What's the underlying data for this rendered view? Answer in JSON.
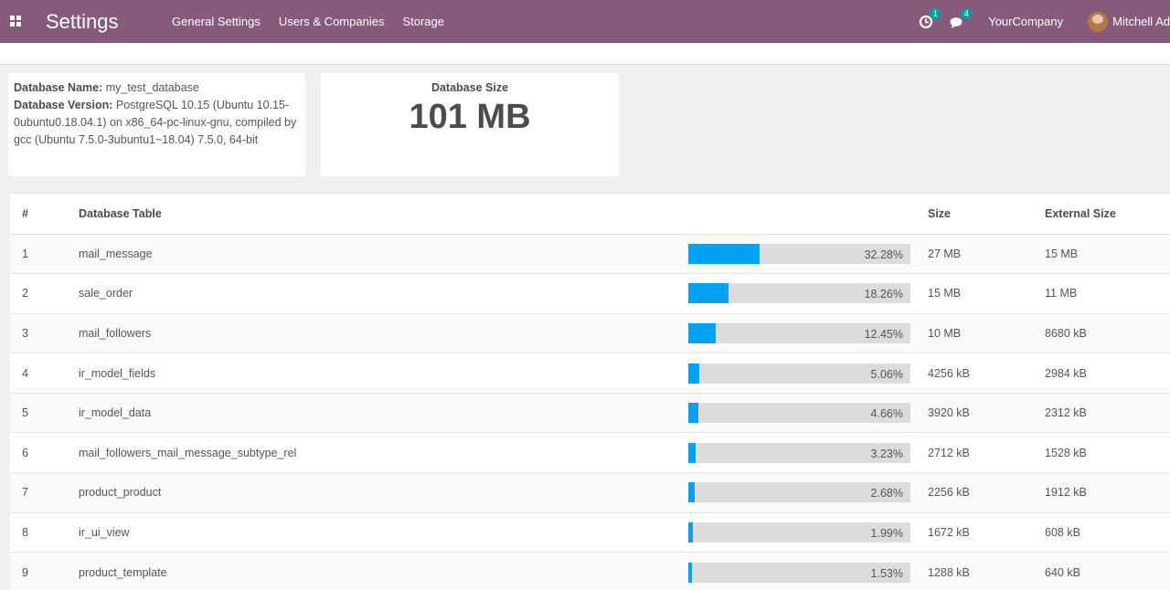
{
  "nav": {
    "app_title": "Settings",
    "menu": [
      "General Settings",
      "Users & Companies",
      "Storage"
    ],
    "activity_badge": "1",
    "messages_badge": "4",
    "company": "YourCompany",
    "user": "Mitchell Ad"
  },
  "db_info": {
    "name_label": "Database Name:",
    "name_value": "my_test_database",
    "version_label": "Database Version:",
    "version_value": "PostgreSQL 10.15 (Ubuntu 10.15-0ubuntu0.18.04.1) on x86_64-pc-linux-gnu, compiled by gcc (Ubuntu 7.5.0-3ubuntu1~18.04) 7.5.0, 64-bit"
  },
  "db_size": {
    "label": "Database Size",
    "value": "101 MB"
  },
  "table": {
    "headers": {
      "num": "#",
      "name": "Database Table",
      "size": "Size",
      "external": "External Size"
    },
    "rows": [
      {
        "num": "1",
        "name": "mail_message",
        "percent": 32.28,
        "percent_label": "32.28%",
        "size": "27 MB",
        "external": "15 MB"
      },
      {
        "num": "2",
        "name": "sale_order",
        "percent": 18.26,
        "percent_label": "18.26%",
        "size": "15 MB",
        "external": "11 MB"
      },
      {
        "num": "3",
        "name": "mail_followers",
        "percent": 12.45,
        "percent_label": "12.45%",
        "size": "10 MB",
        "external": "8680 kB"
      },
      {
        "num": "4",
        "name": "ir_model_fields",
        "percent": 5.06,
        "percent_label": "5.06%",
        "size": "4256 kB",
        "external": "2984 kB"
      },
      {
        "num": "5",
        "name": "ir_model_data",
        "percent": 4.66,
        "percent_label": "4.66%",
        "size": "3920 kB",
        "external": "2312 kB"
      },
      {
        "num": "6",
        "name": "mail_followers_mail_message_subtype_rel",
        "percent": 3.23,
        "percent_label": "3.23%",
        "size": "2712 kB",
        "external": "1528 kB"
      },
      {
        "num": "7",
        "name": "product_product",
        "percent": 2.68,
        "percent_label": "2.68%",
        "size": "2256 kB",
        "external": "1912 kB"
      },
      {
        "num": "8",
        "name": "ir_ui_view",
        "percent": 1.99,
        "percent_label": "1.99%",
        "size": "1672 kB",
        "external": "608 kB"
      },
      {
        "num": "9",
        "name": "product_template",
        "percent": 1.53,
        "percent_label": "1.53%",
        "size": "1288 kB",
        "external": "640 kB"
      }
    ]
  },
  "colors": {
    "navbar": "#875a7b",
    "bar_fill": "#00a2f4",
    "badge": "#00a09d"
  }
}
